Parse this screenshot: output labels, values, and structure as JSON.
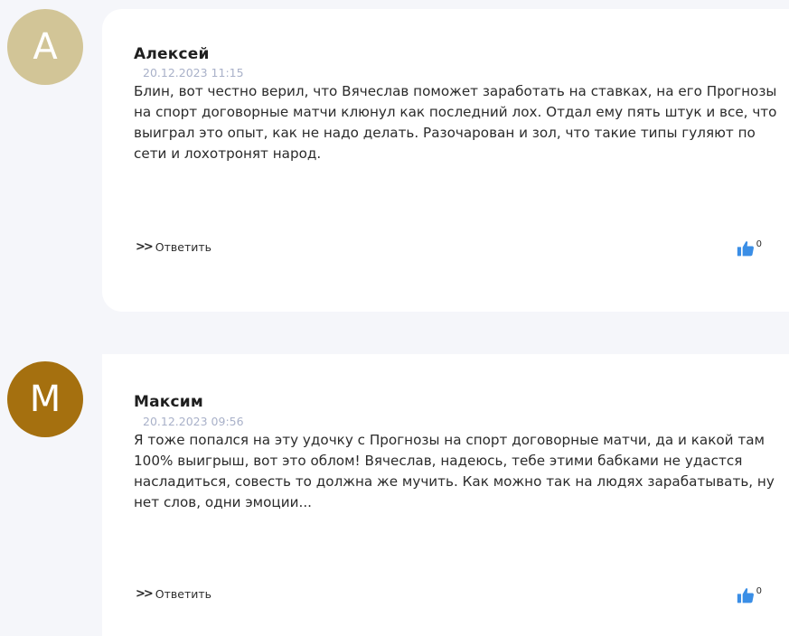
{
  "comments": [
    {
      "avatar_letter": "А",
      "avatar_color": "#d2c597",
      "author": "Алексей",
      "date": "20.12.2023 11:15",
      "text": "Блин, вот честно верил, что Вячеслав поможет заработать на ставках, на его Прогнозы на спорт договорные матчи клюнул как последний лох. Отдал ему пять штук и все, что выиграл это опыт, как не надо делать. Разочарован и зол, что такие типы гуляют по сети и лохотронят народ.",
      "reply_label": "Ответить",
      "reply_icon": "double-chevron-right-icon",
      "likes": "0",
      "like_icon": "thumbs-up-icon"
    },
    {
      "avatar_letter": "М",
      "avatar_color": "#a5700f",
      "author": "Максим",
      "date": "20.12.2023 09:56",
      "text": "Я тоже попался на эту удочку с Прогнозы на спорт договорные матчи, да и какой там 100% выигрыш, вот это облом! Вячеслав, надеюсь, тебе этими бабками не удастся насладиться, совесть то должна же мучить. Как можно так на людях зарабатывать, ну нет слов, одни эмоции...",
      "reply_label": "Ответить",
      "reply_icon": "double-chevron-right-icon",
      "likes": "0",
      "like_icon": "thumbs-up-icon"
    }
  ],
  "colors": {
    "page_background": "#f5f6fa",
    "card_background": "#ffffff",
    "date_text": "#a9b1c9",
    "like_icon": "#3a8ee6"
  }
}
